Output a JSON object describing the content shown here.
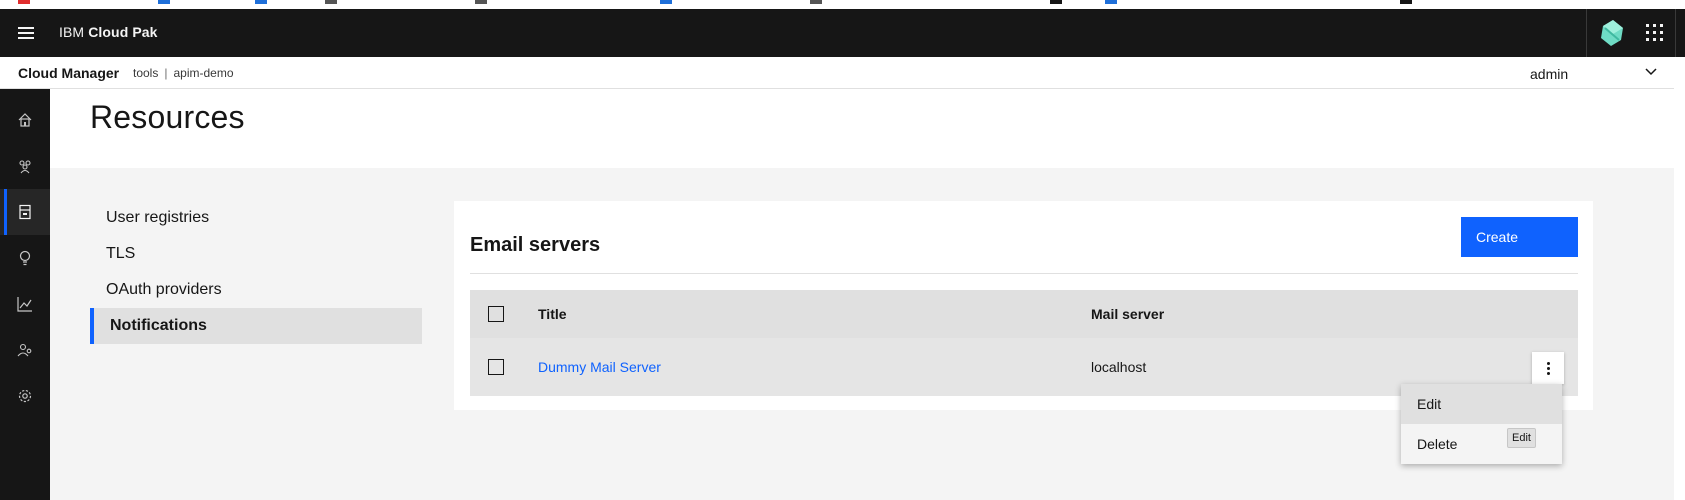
{
  "shell": {
    "brand_prefix": "IBM",
    "brand_name": "Cloud Pak"
  },
  "subheader": {
    "title": "Cloud Manager",
    "crumbs": [
      "tools",
      "apim-demo"
    ],
    "separator": "|",
    "user": "admin"
  },
  "siderail": {
    "items": [
      {
        "icon": "home-icon"
      },
      {
        "icon": "users-icon"
      },
      {
        "icon": "resources-icon",
        "active": true
      },
      {
        "icon": "lightbulb-icon"
      },
      {
        "icon": "analytics-icon"
      },
      {
        "icon": "members-icon"
      },
      {
        "icon": "settings-icon"
      }
    ]
  },
  "page": {
    "title": "Resources"
  },
  "secnav": {
    "items": [
      {
        "label": "User registries"
      },
      {
        "label": "TLS"
      },
      {
        "label": "OAuth providers"
      },
      {
        "label": "Notifications",
        "active": true
      }
    ]
  },
  "card": {
    "title": "Email servers",
    "create_label": "Create",
    "columns": [
      "Title",
      "Mail server"
    ],
    "rows": [
      {
        "title": "Dummy Mail Server",
        "mail_server": "localhost"
      }
    ]
  },
  "overflow_menu": {
    "items": [
      "Edit",
      "Delete"
    ],
    "tooltip": "Edit"
  },
  "colors": {
    "accent": "#0f62fe",
    "shell_bg": "#161616"
  }
}
